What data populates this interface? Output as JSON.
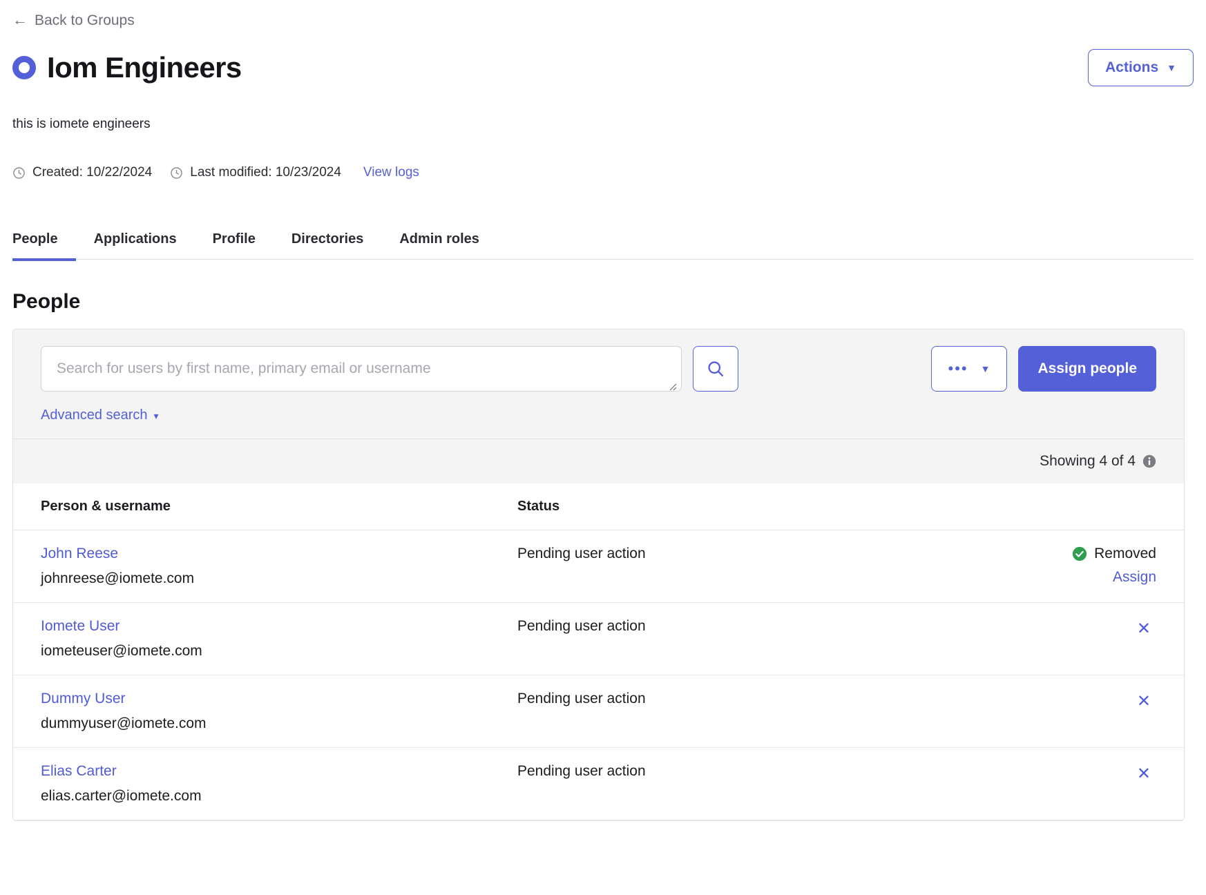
{
  "back_link": {
    "label": "Back to Groups",
    "arrow": "←"
  },
  "header": {
    "title": "Iom Engineers",
    "group_icon": "group-ring-icon",
    "actions_button": {
      "label": "Actions",
      "caret": "▼"
    }
  },
  "description": "this is iomete engineers",
  "meta": {
    "created": "Created: 10/22/2024",
    "last_modified": "Last modified: 10/23/2024",
    "view_logs": "View logs"
  },
  "tabs": [
    {
      "label": "People",
      "active": true
    },
    {
      "label": "Applications",
      "active": false
    },
    {
      "label": "Profile",
      "active": false
    },
    {
      "label": "Directories",
      "active": false
    },
    {
      "label": "Admin roles",
      "active": false
    }
  ],
  "section": {
    "title": "People"
  },
  "toolbar": {
    "search_placeholder": "Search for users by first name, primary email or username",
    "search_value": "",
    "search_button_icon": "search-icon",
    "more_button": {
      "dots": "•••",
      "caret": "▼"
    },
    "assign_people_label": "Assign people",
    "advanced_search": {
      "label": "Advanced search",
      "caret": "▾"
    }
  },
  "showing": {
    "text": "Showing 4 of 4",
    "info_icon": "info-icon"
  },
  "table": {
    "columns": [
      "Person & username",
      "Status",
      ""
    ],
    "rows": [
      {
        "name": "John Reese",
        "email": "johnreese@iomete.com",
        "status": "Pending user action",
        "action_type": "removed",
        "removed_label": "Removed",
        "assign_label": "Assign"
      },
      {
        "name": "Iomete User",
        "email": "iometeuser@iomete.com",
        "status": "Pending user action",
        "action_type": "remove",
        "remove_label": "✕"
      },
      {
        "name": "Dummy User",
        "email": "dummyuser@iomete.com",
        "status": "Pending user action",
        "action_type": "remove",
        "remove_label": "✕"
      },
      {
        "name": "Elias Carter",
        "email": "elias.carter@iomete.com",
        "status": "Pending user action",
        "action_type": "remove",
        "remove_label": "✕"
      }
    ]
  },
  "colors": {
    "accent": "#5460d8",
    "link": "#4f5bd5",
    "success": "#2e9e4f",
    "panel_bg": "#f4f4f5",
    "border": "#e2e2e6"
  }
}
